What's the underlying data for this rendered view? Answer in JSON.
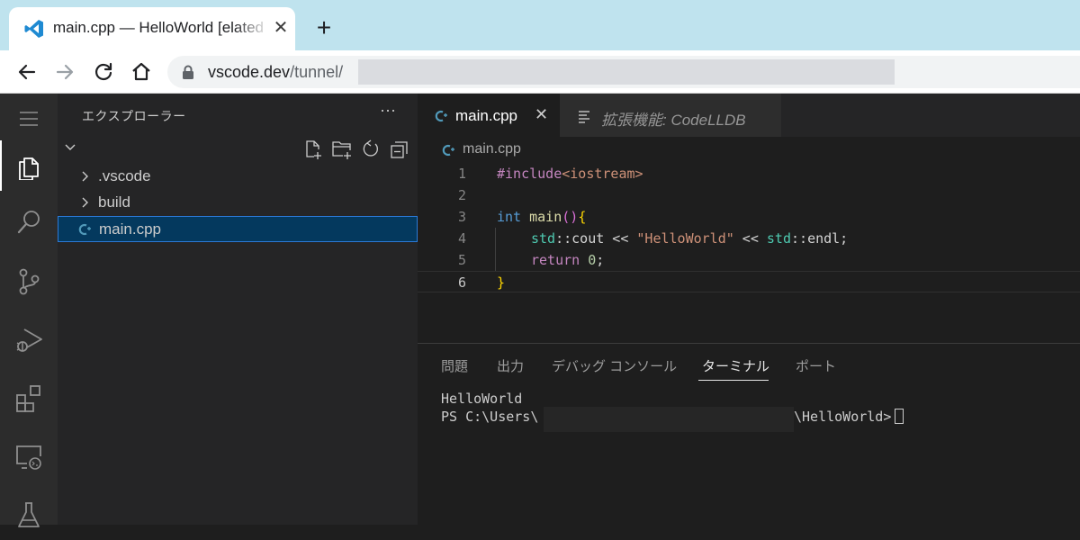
{
  "browser": {
    "tab_title": "main.cpp — HelloWorld [elated",
    "tab_close": "✕",
    "new_tab": "+",
    "url_host": "vscode.dev",
    "url_path": "/tunnel/"
  },
  "explorer": {
    "title": "エクスプローラー",
    "more": "···",
    "items": [
      {
        "label": ".vscode",
        "type": "folder"
      },
      {
        "label": "build",
        "type": "folder"
      },
      {
        "label": "main.cpp",
        "type": "file",
        "selected": true
      }
    ]
  },
  "editor": {
    "tabs": [
      {
        "label": "main.cpp",
        "close": "✕"
      },
      {
        "label": "拡張機能: CodeLLDB"
      }
    ],
    "breadcrumb": "main.cpp",
    "line_numbers": [
      "1",
      "2",
      "3",
      "4",
      "5",
      "6"
    ],
    "code": {
      "l1_directive": "#include",
      "l1_header": "<iostream>",
      "l3_type": "int",
      "l3_fn": "main",
      "l3_parens": "()",
      "l3_brace": "{",
      "l4_ns1": "std",
      "l4_sep1": "::",
      "l4_cout": "cout",
      "l4_op1": " << ",
      "l4_str": "\"HelloWorld\"",
      "l4_op2": " << ",
      "l4_ns2": "std",
      "l4_sep2": "::",
      "l4_endl": "endl;",
      "l5_ret": "return",
      "l5_num": "0",
      "l5_semi": ";",
      "l6_brace": "}"
    }
  },
  "panel": {
    "tabs": [
      "問題",
      "出力",
      "デバッグ コンソール",
      "ターミナル",
      "ポート"
    ],
    "active_tab": "ターミナル",
    "terminal_line1": "HelloWorld",
    "terminal_prompt_start": "PS C:\\Users\\",
    "terminal_prompt_end": "\\HelloWorld>"
  },
  "colors": {
    "accent": "#2b79d6",
    "selection": "#04395e",
    "tabstrip": "#bfe3ee"
  }
}
